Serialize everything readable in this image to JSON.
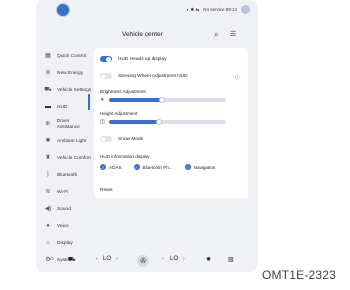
{
  "status": {
    "text": "No service 09:14"
  },
  "header": {
    "title": "Vehicle center"
  },
  "sidebar": {
    "items": [
      {
        "label": "Quick Control",
        "icon": "grid-icon"
      },
      {
        "label": "New Energy",
        "icon": "energy-icon"
      },
      {
        "label": "Vehicle Settings",
        "icon": "car-icon"
      },
      {
        "label": "HUD",
        "icon": "hud-icon"
      },
      {
        "label": "Driver Assistance",
        "icon": "steering-icon"
      },
      {
        "label": "Ambient Light",
        "icon": "light-icon"
      },
      {
        "label": "Vehicle Comfort",
        "icon": "seat-icon"
      },
      {
        "label": "Bluetooth",
        "icon": "bluetooth-icon"
      },
      {
        "label": "Wi-Fi",
        "icon": "wifi-icon"
      },
      {
        "label": "Sound",
        "icon": "sound-icon"
      },
      {
        "label": "Voice",
        "icon": "mic-icon"
      },
      {
        "label": "Display",
        "icon": "display-icon"
      },
      {
        "label": "System",
        "icon": "system-icon"
      }
    ]
  },
  "hud": {
    "heads_up_label": "HUD Heads up display",
    "heads_up_on": true,
    "steering_label": "Steering Wheel Adjustment HUD",
    "steering_on": false,
    "brightness_label": "Brightness Adjustment",
    "brightness_level": 0.45,
    "height_label": "Height Adjustment",
    "height_level": 0.43,
    "snow_label": "Snow Mode",
    "snow_on": false,
    "info_display_label": "HUD information display",
    "info_options": [
      {
        "label": "ADAS",
        "checked": true
      },
      {
        "label": "Bluetooth Ph...",
        "checked": true
      },
      {
        "label": "Navigation",
        "checked": true
      }
    ],
    "reset_label": "Reset"
  },
  "bottombar": {
    "left_temp": "LO",
    "right_temp": "LO"
  },
  "watermark": "OMT1E-2323",
  "colors": {
    "accent": "#3a6ed1",
    "panel": "#ffffff",
    "background": "#f0f1f5"
  }
}
